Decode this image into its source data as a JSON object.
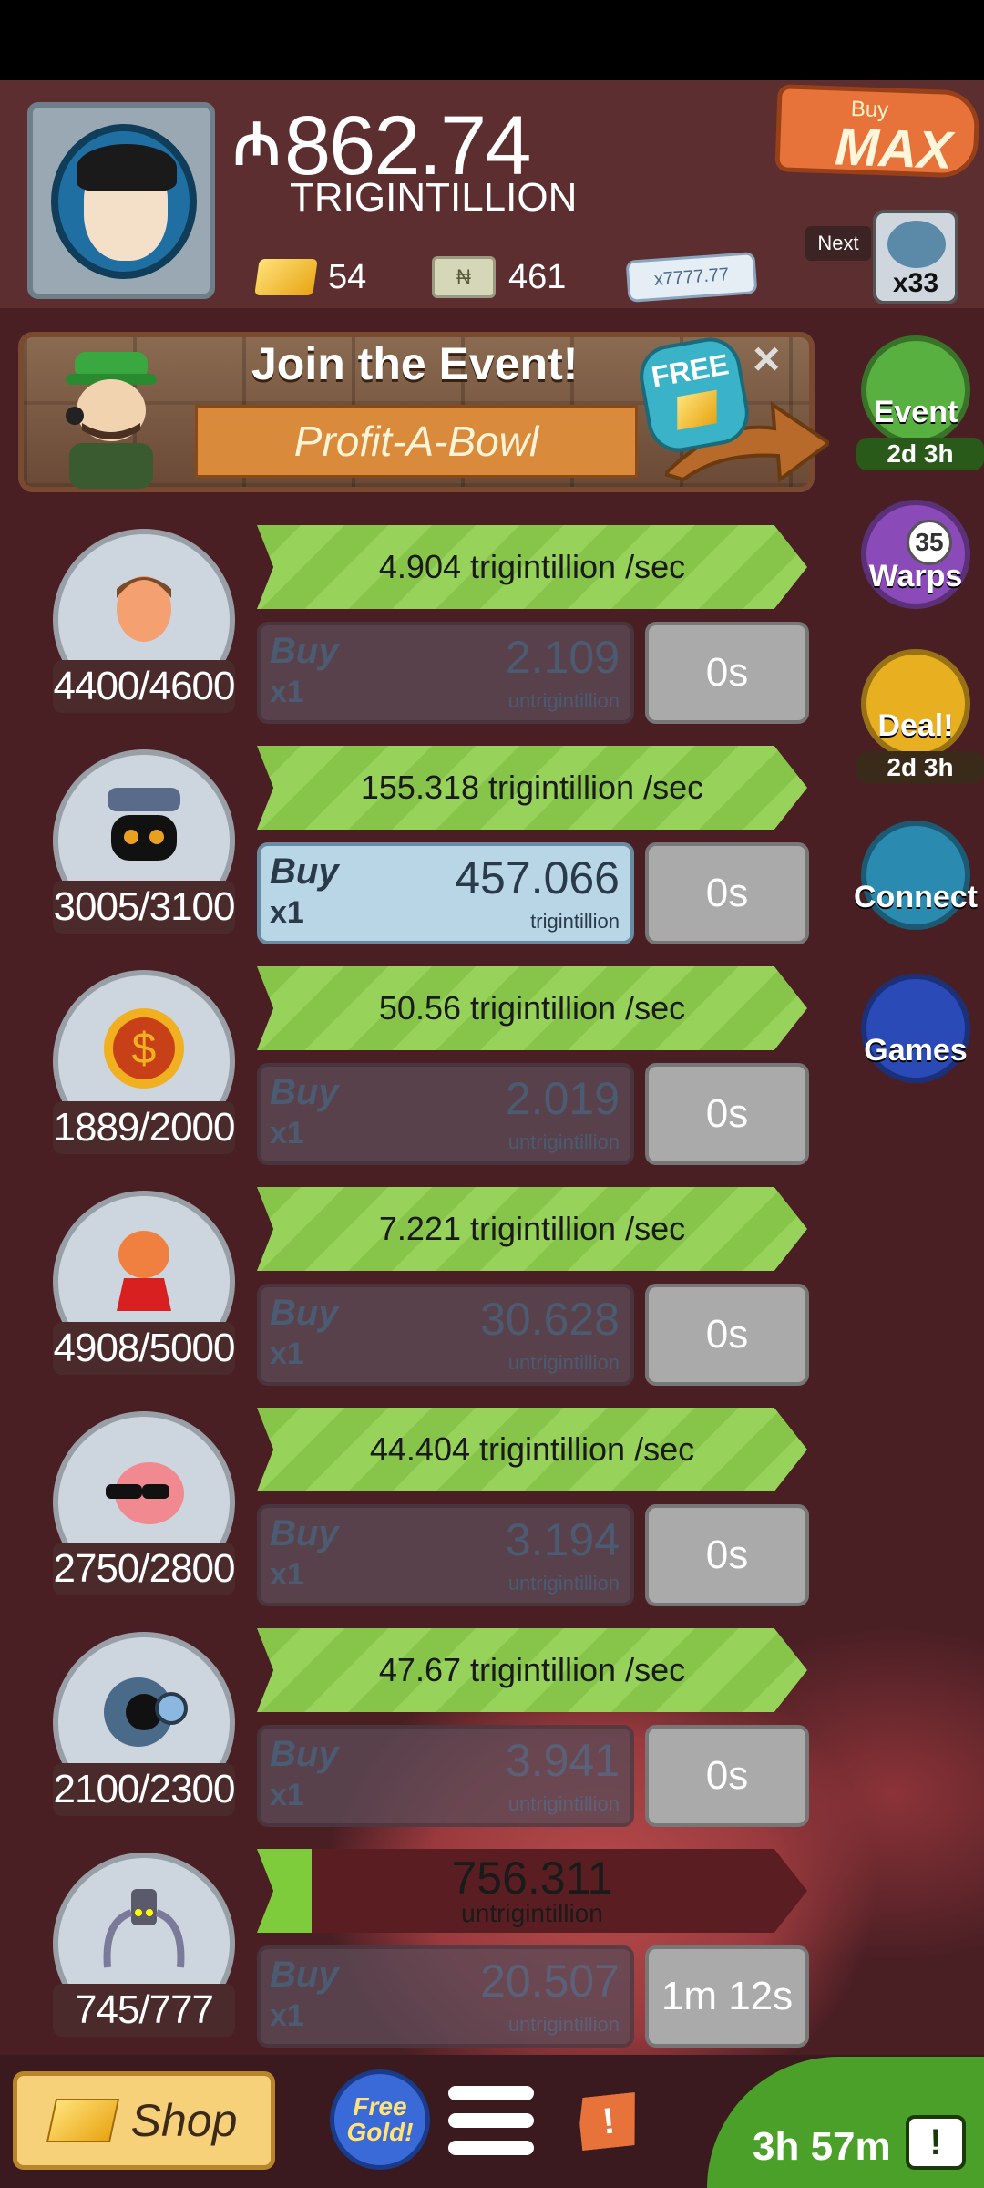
{
  "header": {
    "money_symbol": "₼",
    "money_value": "862.74",
    "money_unit": "TRIGINTILLION",
    "gold_count": "54",
    "megabucks_count": "461",
    "bill_label": "x7777.77"
  },
  "buy_max": {
    "small": "Buy",
    "big": "MAX"
  },
  "next": {
    "label": "Next",
    "count": "x33"
  },
  "event_banner": {
    "title": "Join the Event!",
    "subtitle": "Profit-A-Bowl",
    "free_label": "FREE",
    "close": "×"
  },
  "side_menu": {
    "event_label": "Event",
    "event_timer": "2d 3h",
    "warps_label": "Warps",
    "warps_count": "35",
    "deal_label": "Deal!",
    "deal_timer": "2d 3h",
    "connect_label": "Connect",
    "games_label": "Games"
  },
  "businesses": [
    {
      "count": "4400/4600",
      "rate": "4.904 trigintillion /sec",
      "buy_label": "Buy",
      "buy_qty": "x1",
      "cost": "2.109",
      "cost_unit": "untrigintillion",
      "time": "0s"
    },
    {
      "count": "3005/3100",
      "rate": "155.318 trigintillion /sec",
      "buy_label": "Buy",
      "buy_qty": "x1",
      "cost": "457.066",
      "cost_unit": "trigintillion",
      "time": "0s"
    },
    {
      "count": "1889/2000",
      "rate": "50.56 trigintillion /sec",
      "buy_label": "Buy",
      "buy_qty": "x1",
      "cost": "2.019",
      "cost_unit": "untrigintillion",
      "time": "0s"
    },
    {
      "count": "4908/5000",
      "rate": "7.221 trigintillion /sec",
      "buy_label": "Buy",
      "buy_qty": "x1",
      "cost": "30.628",
      "cost_unit": "untrigintillion",
      "time": "0s"
    },
    {
      "count": "2750/2800",
      "rate": "44.404 trigintillion /sec",
      "buy_label": "Buy",
      "buy_qty": "x1",
      "cost": "3.194",
      "cost_unit": "untrigintillion",
      "time": "0s"
    },
    {
      "count": "2100/2300",
      "rate": "47.67 trigintillion /sec",
      "buy_label": "Buy",
      "buy_qty": "x1",
      "cost": "3.941",
      "cost_unit": "untrigintillion",
      "time": "0s"
    },
    {
      "count": "745/777",
      "progress_value": "756.311",
      "progress_unit": "untrigintillion",
      "progress_fraction": 0.1,
      "buy_label": "Buy",
      "buy_qty": "x1",
      "cost": "20.507",
      "cost_unit": "untrigintillion",
      "time": "1m 12s"
    }
  ],
  "bottom_bar": {
    "shop_label": "Shop",
    "free_gold_label": "Free Gold!",
    "alert_label": "!",
    "tv_timer": "3h 57m",
    "tv_icon": "!"
  },
  "colors": {
    "rate_green": "#86c44a",
    "buy_active": "#b9d6e6",
    "buy_max_orange": "#e8733a",
    "background": "#4a1f24"
  }
}
